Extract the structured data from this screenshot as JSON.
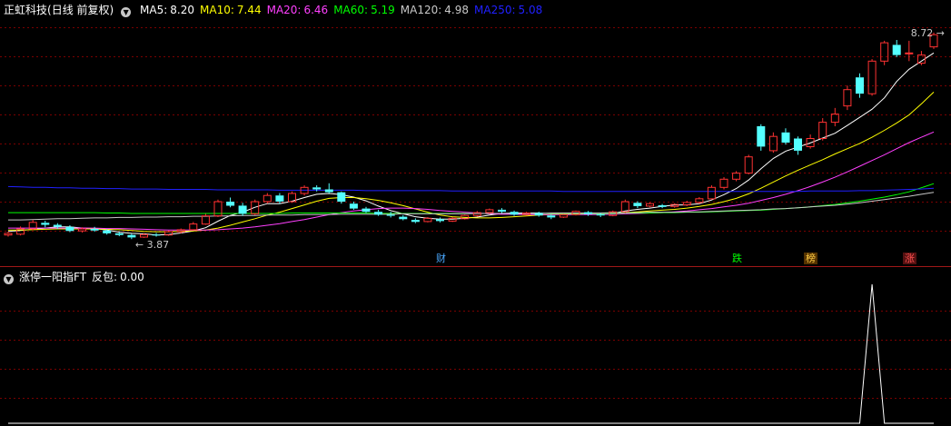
{
  "main_panel": {
    "stock_name": "正虹科技",
    "period": "(日线 前复权)",
    "ma": [
      {
        "label": "MA5:",
        "value": "8.20",
        "color": "#ffffff"
      },
      {
        "label": "MA10:",
        "value": "7.44",
        "color": "#ffff00"
      },
      {
        "label": "MA20:",
        "value": "6.46",
        "color": "#ff40ff"
      },
      {
        "label": "MA60:",
        "value": "5.19",
        "color": "#00ff00"
      },
      {
        "label": "MA120:",
        "value": "4.98",
        "color": "#c8c8c8"
      },
      {
        "label": "MA250:",
        "value": "5.08",
        "color": "#2020ff"
      }
    ],
    "high_annotation": "8.72",
    "low_annotation": "3.87",
    "events": [
      {
        "label": "财",
        "color": "#4aa8ff",
        "bg": "#000000"
      },
      {
        "label": "跌",
        "color": "#00ff00",
        "bg": "#000000"
      },
      {
        "label": "榜",
        "color": "#ffcc44",
        "bg": "#553300"
      },
      {
        "label": "涨",
        "color": "#ff5050",
        "bg": "#551111"
      }
    ]
  },
  "indicator_panel": {
    "title": "涨停一阳指FT",
    "field_label": "反包:",
    "field_value": "0.00"
  },
  "chart_data": {
    "type": "candlestick",
    "y_range": [
      3.5,
      9.3
    ],
    "candles": [
      [
        3.93,
        3.97,
        3.89,
        4.01
      ],
      [
        3.95,
        4.08,
        3.92,
        4.14
      ],
      [
        4.08,
        4.24,
        4.05,
        4.3
      ],
      [
        4.23,
        4.18,
        4.12,
        4.28
      ],
      [
        4.18,
        4.13,
        4.08,
        4.22
      ],
      [
        4.13,
        4.03,
        4.0,
        4.17
      ],
      [
        4.03,
        4.08,
        3.99,
        4.12
      ],
      [
        4.08,
        4.04,
        4.01,
        4.13
      ],
      [
        4.04,
        3.97,
        3.94,
        4.07
      ],
      [
        3.97,
        3.93,
        3.9,
        4.02
      ],
      [
        3.93,
        3.87,
        3.83,
        3.96
      ],
      [
        3.88,
        3.94,
        3.86,
        3.97
      ],
      [
        3.94,
        3.93,
        3.89,
        3.98
      ],
      [
        3.93,
        4.01,
        3.91,
        4.04
      ],
      [
        4.01,
        4.06,
        3.97,
        4.09
      ],
      [
        4.06,
        4.2,
        4.04,
        4.25
      ],
      [
        4.2,
        4.4,
        4.18,
        4.45
      ],
      [
        4.4,
        4.75,
        4.37,
        4.8
      ],
      [
        4.75,
        4.65,
        4.61,
        4.85
      ],
      [
        4.65,
        4.45,
        4.4,
        4.72
      ],
      [
        4.45,
        4.75,
        4.42,
        4.8
      ],
      [
        4.75,
        4.9,
        4.7,
        4.96
      ],
      [
        4.9,
        4.75,
        4.7,
        4.96
      ],
      [
        4.75,
        4.95,
        4.72,
        5.0
      ],
      [
        4.95,
        5.1,
        4.9,
        5.15
      ],
      [
        5.1,
        5.05,
        5.0,
        5.15
      ],
      [
        5.05,
        4.98,
        4.95,
        5.2
      ],
      [
        4.98,
        4.75,
        4.7,
        5.0
      ],
      [
        4.7,
        4.58,
        4.55,
        4.75
      ],
      [
        4.58,
        4.5,
        4.47,
        4.62
      ],
      [
        4.5,
        4.43,
        4.4,
        4.55
      ],
      [
        4.43,
        4.4,
        4.36,
        4.5
      ],
      [
        4.38,
        4.32,
        4.29,
        4.42
      ],
      [
        4.3,
        4.25,
        4.22,
        4.34
      ],
      [
        4.26,
        4.34,
        4.24,
        4.37
      ],
      [
        4.32,
        4.27,
        4.24,
        4.36
      ],
      [
        4.27,
        4.34,
        4.25,
        4.37
      ],
      [
        4.33,
        4.41,
        4.31,
        4.43
      ],
      [
        4.41,
        4.48,
        4.38,
        4.52
      ],
      [
        4.48,
        4.55,
        4.45,
        4.58
      ],
      [
        4.55,
        4.5,
        4.47,
        4.59
      ],
      [
        4.5,
        4.43,
        4.4,
        4.53
      ],
      [
        4.43,
        4.47,
        4.4,
        4.5
      ],
      [
        4.47,
        4.41,
        4.38,
        4.5
      ],
      [
        4.41,
        4.36,
        4.32,
        4.44
      ],
      [
        4.37,
        4.43,
        4.35,
        4.45
      ],
      [
        4.43,
        4.51,
        4.41,
        4.53
      ],
      [
        4.49,
        4.44,
        4.4,
        4.52
      ],
      [
        4.44,
        4.41,
        4.37,
        4.47
      ],
      [
        4.41,
        4.5,
        4.39,
        4.53
      ],
      [
        4.5,
        4.75,
        4.47,
        4.8
      ],
      [
        4.72,
        4.64,
        4.59,
        4.76
      ],
      [
        4.64,
        4.7,
        4.61,
        4.73
      ],
      [
        4.66,
        4.62,
        4.59,
        4.69
      ],
      [
        4.63,
        4.68,
        4.6,
        4.71
      ],
      [
        4.67,
        4.73,
        4.64,
        4.77
      ],
      [
        4.73,
        4.82,
        4.7,
        4.86
      ],
      [
        4.82,
        5.1,
        4.8,
        5.15
      ],
      [
        5.1,
        5.3,
        5.05,
        5.35
      ],
      [
        5.3,
        5.45,
        5.25,
        5.5
      ],
      [
        5.45,
        5.85,
        5.42,
        5.9
      ],
      [
        6.6,
        6.1,
        6.0,
        6.65
      ],
      [
        6.0,
        6.35,
        5.95,
        6.45
      ],
      [
        6.45,
        6.2,
        6.15,
        6.55
      ],
      [
        6.3,
        6.0,
        5.9,
        6.35
      ],
      [
        6.1,
        6.3,
        6.05,
        6.4
      ],
      [
        6.3,
        6.7,
        6.25,
        6.8
      ],
      [
        6.7,
        6.9,
        6.6,
        7.05
      ],
      [
        7.1,
        7.5,
        7.0,
        7.6
      ],
      [
        7.8,
        7.4,
        7.3,
        7.9
      ],
      [
        7.4,
        8.2,
        7.35,
        8.25
      ],
      [
        8.2,
        8.65,
        8.1,
        8.7
      ],
      [
        8.6,
        8.35,
        8.3,
        8.72
      ],
      [
        8.4,
        8.4,
        8.2,
        8.7
      ],
      [
        8.15,
        8.35,
        8.1,
        8.45
      ],
      [
        8.55,
        8.85,
        8.5,
        8.9
      ]
    ],
    "ma_series": {
      "MA5": [
        4.02,
        4.04,
        4.07,
        4.1,
        4.13,
        4.13,
        4.1,
        4.09,
        4.05,
        4.0,
        3.97,
        3.96,
        3.93,
        3.94,
        3.98,
        4.03,
        4.11,
        4.27,
        4.41,
        4.49,
        4.61,
        4.7,
        4.7,
        4.76,
        4.85,
        4.93,
        4.95,
        4.92,
        4.86,
        4.77,
        4.64,
        4.53,
        4.45,
        4.38,
        4.34,
        4.32,
        4.32,
        4.34,
        4.37,
        4.42,
        4.46,
        4.47,
        4.47,
        4.47,
        4.45,
        4.43,
        4.44,
        4.45,
        4.45,
        4.46,
        4.52,
        4.56,
        4.59,
        4.63,
        4.67,
        4.67,
        4.7,
        4.79,
        4.92,
        5.07,
        5.28,
        5.56,
        5.81,
        5.99,
        6.09,
        6.19,
        6.31,
        6.43,
        6.62,
        6.82,
        7.02,
        7.3,
        7.7,
        8.0,
        8.2,
        8.4
      ],
      "MA10": [
        4.05,
        4.05,
        4.06,
        4.07,
        4.08,
        4.08,
        4.08,
        4.08,
        4.07,
        4.06,
        4.04,
        4.02,
        4.01,
        4.01,
        4.02,
        4.03,
        4.05,
        4.1,
        4.17,
        4.25,
        4.33,
        4.42,
        4.49,
        4.58,
        4.67,
        4.76,
        4.83,
        4.85,
        4.85,
        4.82,
        4.78,
        4.72,
        4.65,
        4.57,
        4.49,
        4.42,
        4.38,
        4.36,
        4.35,
        4.35,
        4.36,
        4.38,
        4.4,
        4.42,
        4.43,
        4.44,
        4.45,
        4.46,
        4.46,
        4.46,
        4.48,
        4.5,
        4.52,
        4.54,
        4.56,
        4.59,
        4.63,
        4.68,
        4.75,
        4.83,
        4.94,
        5.08,
        5.23,
        5.38,
        5.52,
        5.65,
        5.78,
        5.92,
        6.05,
        6.18,
        6.33,
        6.5,
        6.68,
        6.88,
        7.15,
        7.44
      ],
      "MA20": [
        4.1,
        4.1,
        4.1,
        4.1,
        4.1,
        4.1,
        4.1,
        4.1,
        4.09,
        4.09,
        4.08,
        4.07,
        4.06,
        4.05,
        4.05,
        4.05,
        4.05,
        4.06,
        4.08,
        4.1,
        4.13,
        4.17,
        4.21,
        4.26,
        4.31,
        4.37,
        4.43,
        4.48,
        4.52,
        4.55,
        4.58,
        4.59,
        4.59,
        4.58,
        4.56,
        4.53,
        4.51,
        4.49,
        4.47,
        4.45,
        4.44,
        4.44,
        4.43,
        4.43,
        4.43,
        4.43,
        4.43,
        4.43,
        4.43,
        4.44,
        4.45,
        4.46,
        4.47,
        4.48,
        4.5,
        4.52,
        4.55,
        4.58,
        4.62,
        4.66,
        4.71,
        4.78,
        4.85,
        4.93,
        5.02,
        5.12,
        5.23,
        5.35,
        5.48,
        5.62,
        5.76,
        5.9,
        6.05,
        6.2,
        6.33,
        6.46
      ],
      "MA60": [
        4.48,
        4.48,
        4.48,
        4.48,
        4.48,
        4.48,
        4.48,
        4.48,
        4.47,
        4.47,
        4.46,
        4.46,
        4.46,
        4.46,
        4.46,
        4.46,
        4.46,
        4.46,
        4.46,
        4.46,
        4.46,
        4.46,
        4.46,
        4.47,
        4.47,
        4.47,
        4.47,
        4.47,
        4.47,
        4.47,
        4.46,
        4.46,
        4.46,
        4.46,
        4.46,
        4.46,
        4.46,
        4.46,
        4.46,
        4.46,
        4.46,
        4.46,
        4.46,
        4.46,
        4.46,
        4.46,
        4.46,
        4.46,
        4.46,
        4.46,
        4.47,
        4.47,
        4.47,
        4.48,
        4.48,
        4.49,
        4.49,
        4.5,
        4.51,
        4.52,
        4.53,
        4.54,
        4.56,
        4.58,
        4.6,
        4.62,
        4.65,
        4.68,
        4.72,
        4.76,
        4.81,
        4.86,
        4.92,
        4.99,
        5.09,
        5.19
      ],
      "MA120": [
        4.3,
        4.3,
        4.31,
        4.32,
        4.33,
        4.33,
        4.34,
        4.35,
        4.35,
        4.36,
        4.36,
        4.37,
        4.37,
        4.38,
        4.38,
        4.39,
        4.39,
        4.4,
        4.4,
        4.41,
        4.41,
        4.42,
        4.42,
        4.42,
        4.43,
        4.43,
        4.43,
        4.44,
        4.44,
        4.44,
        4.44,
        4.44,
        4.45,
        4.45,
        4.45,
        4.45,
        4.45,
        4.45,
        4.46,
        4.46,
        4.46,
        4.46,
        4.46,
        4.46,
        4.47,
        4.47,
        4.47,
        4.47,
        4.47,
        4.48,
        4.48,
        4.48,
        4.49,
        4.49,
        4.49,
        4.5,
        4.5,
        4.51,
        4.52,
        4.53,
        4.54,
        4.55,
        4.57,
        4.58,
        4.6,
        4.62,
        4.64,
        4.66,
        4.69,
        4.72,
        4.76,
        4.8,
        4.84,
        4.88,
        4.93,
        4.98
      ],
      "MA250": [
        5.12,
        5.11,
        5.1,
        5.1,
        5.09,
        5.09,
        5.08,
        5.08,
        5.07,
        5.07,
        5.06,
        5.06,
        5.06,
        5.05,
        5.05,
        5.05,
        5.05,
        5.04,
        5.04,
        5.04,
        5.04,
        5.04,
        5.03,
        5.03,
        5.03,
        5.03,
        5.03,
        5.03,
        5.03,
        5.02,
        5.02,
        5.02,
        5.02,
        5.02,
        5.02,
        5.02,
        5.01,
        5.01,
        5.01,
        5.01,
        5.01,
        5.01,
        5.01,
        5.01,
        5.01,
        5.0,
        5.0,
        5.0,
        5.0,
        5.0,
        5.0,
        5.0,
        5.0,
        5.0,
        5.0,
        5.0,
        5.0,
        5.0,
        5.0,
        5.0,
        5.0,
        5.0,
        5.0,
        5.0,
        5.0,
        5.01,
        5.01,
        5.01,
        5.01,
        5.02,
        5.02,
        5.03,
        5.04,
        5.05,
        5.06,
        5.08
      ]
    },
    "event_index": [
      35,
      59,
      65,
      73
    ],
    "indicator": {
      "y_range": [
        0,
        1
      ],
      "values": [
        0,
        0,
        0,
        0,
        0,
        0,
        0,
        0,
        0,
        0,
        0,
        0,
        0,
        0,
        0,
        0,
        0,
        0,
        0,
        0,
        0,
        0,
        0,
        0,
        0,
        0,
        0,
        0,
        0,
        0,
        0,
        0,
        0,
        0,
        0,
        0,
        0,
        0,
        0,
        0,
        0,
        0,
        0,
        0,
        0,
        0,
        0,
        0,
        0,
        0,
        0,
        0,
        0,
        0,
        0,
        0,
        0,
        0,
        0,
        0,
        0,
        0,
        0,
        0,
        0,
        0,
        0,
        0,
        0,
        0,
        1,
        0,
        0,
        0,
        0,
        0
      ]
    }
  }
}
